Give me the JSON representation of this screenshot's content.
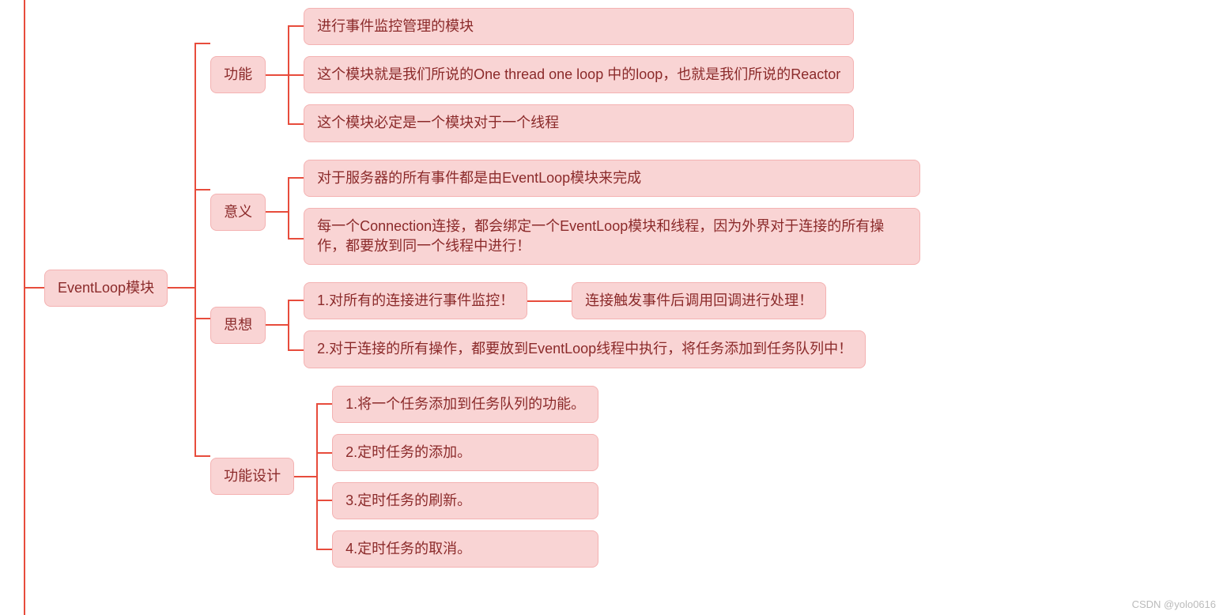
{
  "root": {
    "label": "EventLoop模块"
  },
  "branches": {
    "b1": {
      "label": "功能",
      "items": [
        "进行事件监控管理的模块",
        "这个模块就是我们所说的One thread one loop 中的loop，也就是我们所说的Reactor",
        "这个模块必定是一个模块对于一个线程"
      ]
    },
    "b2": {
      "label": "意义",
      "items": [
        "对于服务器的所有事件都是由EventLoop模块来完成",
        "每一个Connection连接，都会绑定一个EventLoop模块和线程，因为外界对于连接的所有操作，都要放到同一个线程中进行！"
      ]
    },
    "b3": {
      "label": "思想",
      "items": [
        "1.对所有的连接进行事件监控！",
        "2.对于连接的所有操作，都要放到EventLoop线程中执行，将任务添加到任务队列中！"
      ],
      "sub": "连接触发事件后调用回调进行处理！"
    },
    "b4": {
      "label": "功能设计",
      "items": [
        "1.将一个任务添加到任务队列的功能。",
        "2.定时任务的添加。",
        "3.定时任务的刷新。",
        "4.定时任务的取消。"
      ]
    }
  },
  "watermark": "CSDN @yolo0616"
}
